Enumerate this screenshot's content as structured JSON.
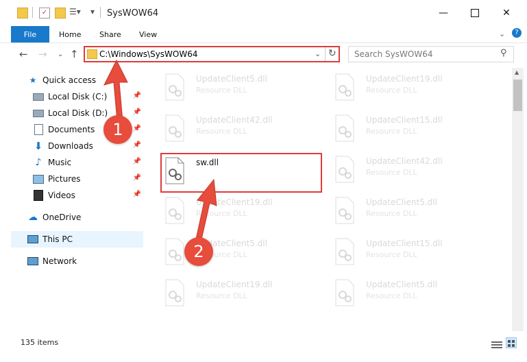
{
  "window": {
    "title": "SysWOW64"
  },
  "ribbon": {
    "tabs": [
      "File",
      "Home",
      "Share",
      "View"
    ]
  },
  "navbar": {
    "address": "C:\\Windows\\SysWOW64",
    "search_placeholder": "Search SysWOW64"
  },
  "sidebar": {
    "quick_access": "Quick access",
    "items": [
      {
        "label": "Local Disk (C:)",
        "icon": "drive-icon"
      },
      {
        "label": "Local Disk (D:)",
        "icon": "drive-icon"
      },
      {
        "label": "Documents",
        "icon": "documents-icon"
      },
      {
        "label": "Downloads",
        "icon": "download-icon"
      },
      {
        "label": "Music",
        "icon": "music-icon"
      },
      {
        "label": "Pictures",
        "icon": "pictures-icon"
      },
      {
        "label": "Videos",
        "icon": "videos-icon"
      }
    ],
    "onedrive": "OneDrive",
    "thispc": "This PC",
    "network": "Network"
  },
  "files": {
    "col1": [
      {
        "name": "UpdateClient5.dll",
        "type": "Resource DLL"
      },
      {
        "name": "UpdateClient42.dll",
        "type": "Resource DLL"
      },
      {
        "name": "sw.dll",
        "type": ""
      },
      {
        "name": "UpdateClient19.dll",
        "type": "Resource DLL"
      },
      {
        "name": "UpdateClient5.dll",
        "type": "Resource DLL"
      },
      {
        "name": "UpdateClient19.dll",
        "type": "Resource DLL"
      }
    ],
    "col2": [
      {
        "name": "UpdateClient19.dll",
        "type": "Resource DLL"
      },
      {
        "name": "UpdateClient15.dll",
        "type": "Resource DLL"
      },
      {
        "name": "UpdateClient42.dll",
        "type": "Resource DLL"
      },
      {
        "name": "UpdateClient5.dll",
        "type": "Resource DLL"
      },
      {
        "name": "UpdateClient15.dll",
        "type": "Resource DLL"
      },
      {
        "name": "UpdateClient5.dll",
        "type": "Resource DLL"
      }
    ]
  },
  "status": {
    "items": "135 items"
  },
  "steps": [
    "1",
    "2"
  ],
  "colors": {
    "accent": "#1979ca",
    "annotation": "#e03a3a"
  }
}
